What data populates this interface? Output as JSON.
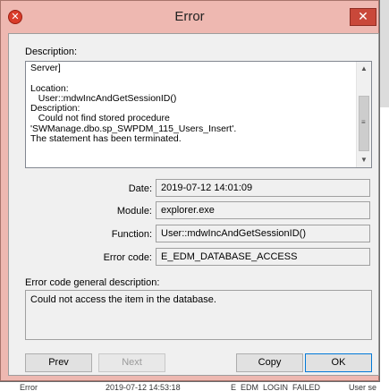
{
  "window": {
    "title": "Error",
    "close_glyph": "✕",
    "icon_glyph": "✕"
  },
  "description": {
    "label": "Description:",
    "lines": [
      "Server]",
      "",
      "Location:",
      "   User::mdwIncAndGetSessionID()",
      "Description:",
      "   Could not find stored procedure",
      "'SWManage.dbo.sp_SWPDM_115_Users_Insert'.",
      "The statement has been terminated."
    ]
  },
  "fields": {
    "date": {
      "label": "Date:",
      "value": "2019-07-12 14:01:09"
    },
    "module": {
      "label": "Module:",
      "value": "explorer.exe"
    },
    "function": {
      "label": "Function:",
      "value": "User::mdwIncAndGetSessionID()"
    },
    "error_code": {
      "label": "Error code:",
      "value": "E_EDM_DATABASE_ACCESS"
    }
  },
  "error_general": {
    "label": "Error code general description:",
    "value": "Could not access the item in the database."
  },
  "buttons": {
    "prev": "Prev",
    "next": "Next",
    "copy": "Copy",
    "ok": "OK"
  },
  "background_row": {
    "status": "Error",
    "timestamp": "2019-07-12 14:53:18",
    "code": "E_EDM_LOGIN_FAILED",
    "user": "User se"
  }
}
